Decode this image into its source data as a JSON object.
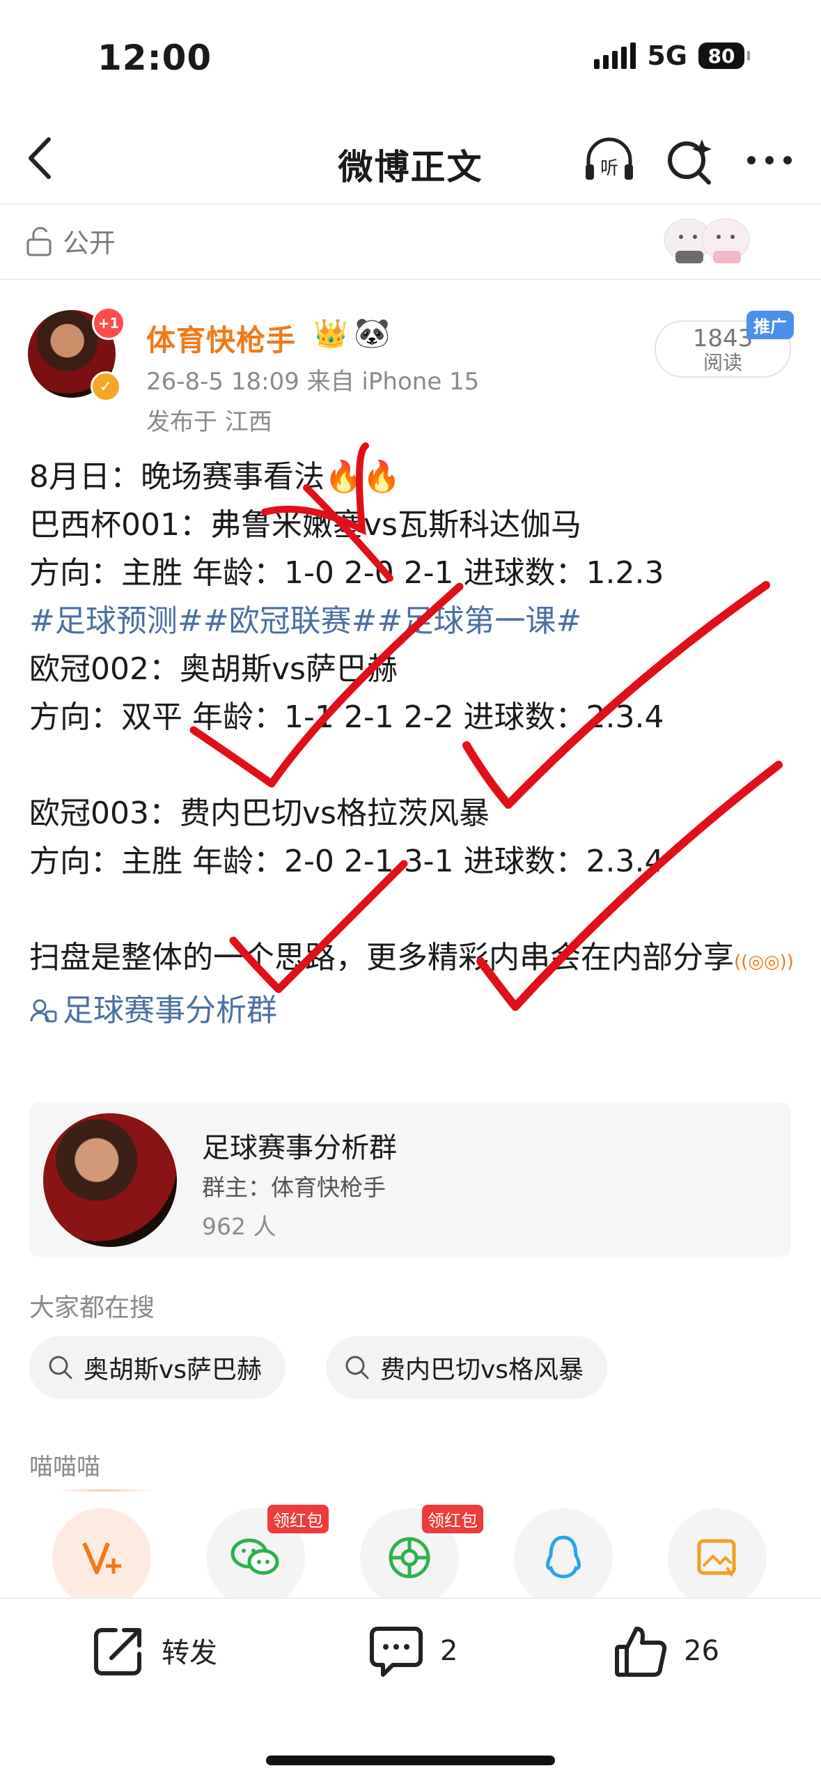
{
  "status": {
    "time": "12:00",
    "network": "5G",
    "battery": "80"
  },
  "nav": {
    "title": "微博正文",
    "listen_icon": "listen-icon",
    "search_icon": "search-sparkle-icon",
    "more_icon": "more-icon"
  },
  "visibility": {
    "label": "公开"
  },
  "author": {
    "avatar_badge": "+1",
    "name": "体育快枪手",
    "meta": "26-8-5 18:09  来自 iPhone 15",
    "location": "发布于 江西",
    "reads_count": "1843",
    "reads_label": "阅读",
    "promo_label": "推广"
  },
  "post": {
    "line1": "8月日：晚场赛事看法🔥🔥",
    "line2": "巴西杯001：弗鲁米嫩塞vs瓦斯科达伽马",
    "line3": "方向：主胜  年龄：1-0  2-0  2-1   进球数：1.2.3",
    "tags": "#足球预测##欧冠联赛##足球第一课#",
    "line5": "欧冠002：奥胡斯vs萨巴赫",
    "line6": "方向：双平  年龄：1-1  2-1  2-2    进球数：2.3.4",
    "line8": "欧冠003：费内巴切vs格拉茨风暴",
    "line9": "方向：主胜   年龄：2-0  2-1  3-1   进球数：2.3.4",
    "line11": "扫盘是整体的一个思路，更多精彩内串会在内部分享",
    "group_link": "足球赛事分析群"
  },
  "group_card": {
    "title": "足球赛事分析群",
    "owner": "群主：体育快枪手",
    "members": "962 人"
  },
  "search": {
    "title": "大家都在搜",
    "chips": [
      "奥胡斯vs萨巴赫",
      "费内巴切vs格风暴"
    ]
  },
  "share": {
    "section_title": "喵喵喵",
    "redpack_label": "领红包",
    "targets": [
      "vplus-icon",
      "wechat-icon",
      "moments-icon",
      "qq-icon",
      "save-image-icon"
    ]
  },
  "bottom_bar": {
    "repost_label": "转发",
    "comment_count": "2",
    "like_count": "26"
  },
  "colors": {
    "accent": "#f07a1a",
    "link": "#4a6fa5",
    "mark": "#e0101a"
  }
}
